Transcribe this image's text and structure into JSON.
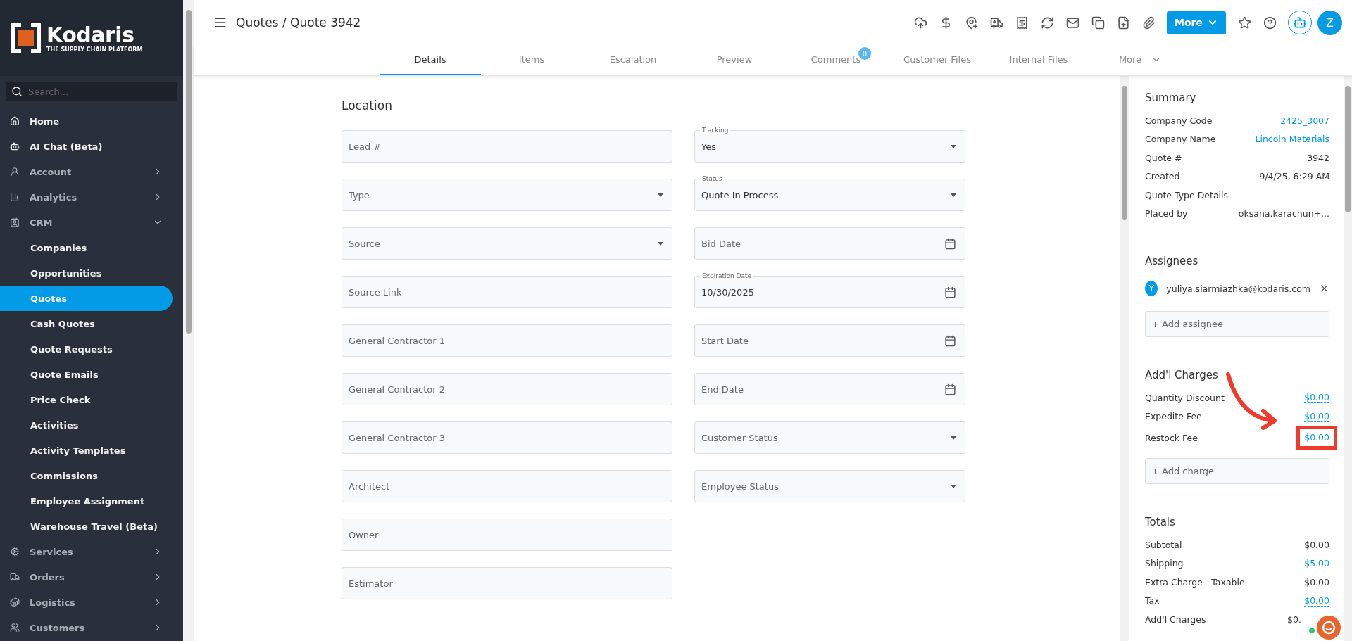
{
  "sidebar": {
    "logo": {
      "name": "Kodaris",
      "tagline": "THE SUPPLY CHAIN PLATFORM"
    },
    "search": {
      "placeholder": "Search..."
    },
    "items": [
      {
        "label": "Home",
        "selected": false
      },
      {
        "label": "AI Chat (Beta)",
        "selected": false
      },
      {
        "label": "Account",
        "expanded": false,
        "selected": false
      },
      {
        "label": "Analytics",
        "expanded": false,
        "selected": false
      },
      {
        "label": "CRM",
        "expanded": true,
        "selected": false,
        "children": [
          {
            "label": "Companies",
            "selected": false
          },
          {
            "label": "Opportunities",
            "selected": false
          },
          {
            "label": "Quotes",
            "selected": true
          },
          {
            "label": "Cash Quotes",
            "selected": false
          },
          {
            "label": "Quote Requests",
            "selected": false
          },
          {
            "label": "Quote Emails",
            "selected": false
          },
          {
            "label": "Price Check",
            "selected": false
          },
          {
            "label": "Activities",
            "selected": false
          },
          {
            "label": "Activity Templates",
            "selected": false
          },
          {
            "label": "Commissions",
            "selected": false
          },
          {
            "label": "Employee Assignment",
            "selected": false
          },
          {
            "label": "Warehouse Travel (Beta)",
            "selected": false
          }
        ]
      },
      {
        "label": "Services",
        "expanded": false,
        "selected": false
      },
      {
        "label": "Orders",
        "expanded": false,
        "selected": false
      },
      {
        "label": "Logistics",
        "expanded": false,
        "selected": false
      },
      {
        "label": "Customers",
        "expanded": false,
        "selected": false
      }
    ]
  },
  "header": {
    "title": "Quotes / Quote 3942",
    "more_button": "More",
    "avatar": "Z"
  },
  "tabs": [
    {
      "label": "Details",
      "selected": true
    },
    {
      "label": "Items",
      "selected": false
    },
    {
      "label": "Escalation",
      "selected": false
    },
    {
      "label": "Preview",
      "selected": false
    },
    {
      "label": "Comments",
      "selected": false,
      "badge": "0"
    },
    {
      "label": "Customer Files",
      "selected": false
    },
    {
      "label": "Internal Files",
      "selected": false
    },
    {
      "label": "More",
      "selected": false,
      "kind": "menu"
    }
  ],
  "form": {
    "title": "Location",
    "left": [
      {
        "kind": "text",
        "placeholder": "Lead #"
      },
      {
        "kind": "select",
        "placeholder": "Type"
      },
      {
        "kind": "select",
        "placeholder": "Source"
      },
      {
        "kind": "text",
        "placeholder": "Source Link"
      },
      {
        "kind": "text",
        "placeholder": "General Contractor 1"
      },
      {
        "kind": "text",
        "placeholder": "General Contractor 2"
      },
      {
        "kind": "text",
        "placeholder": "General Contractor 3"
      },
      {
        "kind": "text",
        "placeholder": "Architect"
      },
      {
        "kind": "text",
        "placeholder": "Owner"
      },
      {
        "kind": "text",
        "placeholder": "Estimator"
      }
    ],
    "right": [
      {
        "kind": "select",
        "label": "Tracking",
        "value": "Yes"
      },
      {
        "kind": "select",
        "label": "Status",
        "value": "Quote In Process"
      },
      {
        "kind": "date",
        "placeholder": "Bid Date"
      },
      {
        "kind": "date",
        "label": "Expiration Date",
        "value": "10/30/2025"
      },
      {
        "kind": "date",
        "placeholder": "Start Date"
      },
      {
        "kind": "date",
        "placeholder": "End Date"
      },
      {
        "kind": "select",
        "placeholder": "Customer Status"
      },
      {
        "kind": "select",
        "placeholder": "Employee Status"
      }
    ]
  },
  "summary": {
    "title": "Summary",
    "rows": [
      {
        "label": "Company Code",
        "value": "2425_3007",
        "link": true
      },
      {
        "label": "Company Name",
        "value": "Lincoln Materials",
        "link": true
      },
      {
        "label": "Quote #",
        "value": "3942",
        "link": false
      },
      {
        "label": "Created",
        "value": "9/4/25, 6:29 AM",
        "link": false
      },
      {
        "label": "Quote Type Details",
        "value": "---",
        "link": false
      },
      {
        "label": "Placed by",
        "value": "oksana.karachun+...",
        "link": false
      }
    ]
  },
  "assignees": {
    "title": "Assignees",
    "people": [
      {
        "initial": "Y",
        "email": "yuliya.siarmiazhka@kodaris.com"
      }
    ],
    "add_placeholder": "+ Add assignee"
  },
  "charges": {
    "title": "Add'l Charges",
    "rows": [
      {
        "label": "Quantity Discount",
        "value": "$0.00",
        "highlighted": false
      },
      {
        "label": "Expedite Fee",
        "value": "$0.00",
        "highlighted": false
      },
      {
        "label": "Restock Fee",
        "value": "$0.00",
        "highlighted": true
      }
    ],
    "add_placeholder": "+ Add charge"
  },
  "totals": {
    "title": "Totals",
    "rows": [
      {
        "label": "Subtotal",
        "value": "$0.00",
        "link": false
      },
      {
        "label": "Shipping",
        "value": "$5.00",
        "link": true
      },
      {
        "label": "Extra Charge - Taxable",
        "value": "$0.00",
        "link": false
      },
      {
        "label": "Tax",
        "value": "$0.00",
        "link": true
      },
      {
        "label": "Add'l Charges",
        "value": "$0.",
        "link": false
      }
    ]
  }
}
